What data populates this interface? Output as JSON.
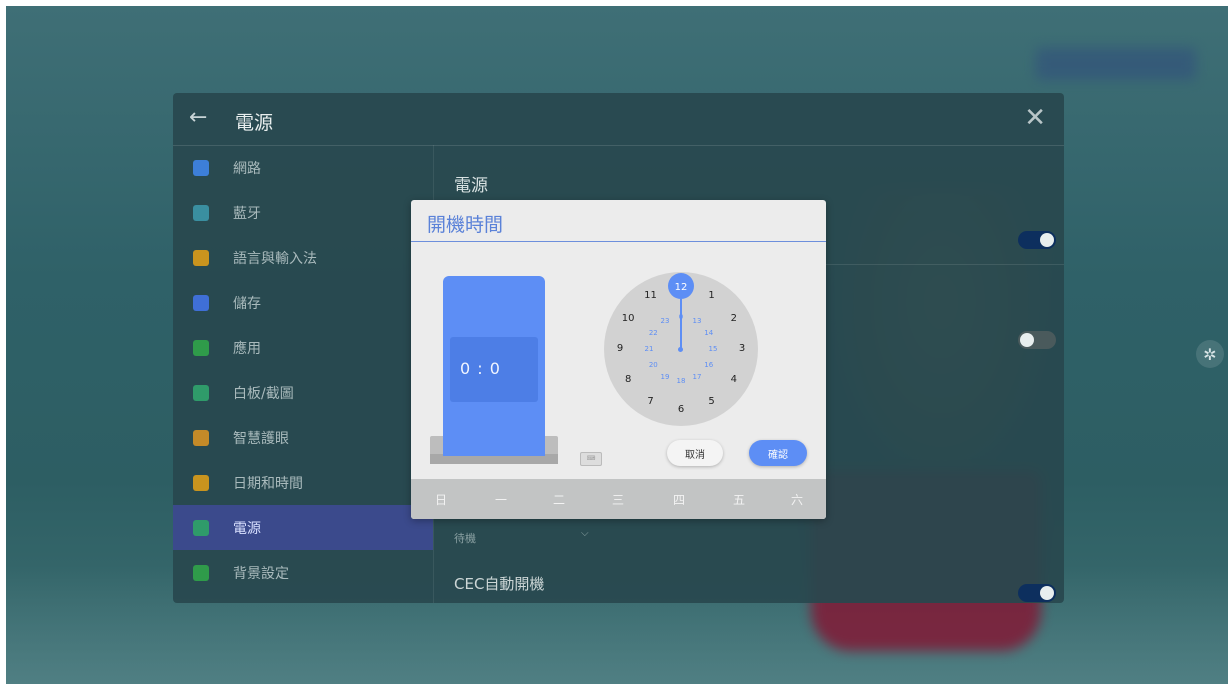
{
  "panel": {
    "title": "電源",
    "sidebar": [
      {
        "label": "網路",
        "icon": "globe-icon",
        "color": "#3d7fd8"
      },
      {
        "label": "藍牙",
        "icon": "bluetooth-icon",
        "color": "#3a8fa0"
      },
      {
        "label": "語言與輸入法",
        "icon": "keyboard-icon",
        "color": "#c9941e"
      },
      {
        "label": "儲存",
        "icon": "storage-icon",
        "color": "#3f6fd6"
      },
      {
        "label": "應用",
        "icon": "apps-icon",
        "color": "#2f9b4a"
      },
      {
        "label": "白板/截圖",
        "icon": "whiteboard-icon",
        "color": "#2f9b6a"
      },
      {
        "label": "智慧護眼",
        "icon": "eye-icon",
        "color": "#c48a28"
      },
      {
        "label": "日期和時間",
        "icon": "calendar-icon",
        "color": "#c9941e"
      },
      {
        "label": "電源",
        "icon": "power-icon",
        "color": "#2f9b6a",
        "active": true
      },
      {
        "label": "背景設定",
        "icon": "image-icon",
        "color": "#2f9b4a"
      }
    ],
    "content": {
      "section_title": "電源",
      "sub_value": "待機",
      "cec_title": "CEC自動開機",
      "toggles": [
        {
          "state": "on"
        },
        {
          "state": "off"
        },
        {
          "state": "on"
        }
      ]
    }
  },
  "dialog": {
    "title": "開機時間",
    "time_display": "0 : 0",
    "clock_selected": "12",
    "outer_numbers": [
      "12",
      "1",
      "2",
      "3",
      "4",
      "5",
      "6",
      "7",
      "8",
      "9",
      "10",
      "11"
    ],
    "inner_numbers": [
      "0",
      "13",
      "14",
      "15",
      "16",
      "17",
      "18",
      "19",
      "20",
      "21",
      "22",
      "23"
    ],
    "cancel_label": "取消",
    "ok_label": "確認",
    "weekdays": [
      "日",
      "一",
      "二",
      "三",
      "四",
      "五",
      "六"
    ]
  },
  "colors": {
    "accent": "#5d8ef5",
    "active_item": "#3b4a8c",
    "toggle_on": "#0d2f5e"
  }
}
